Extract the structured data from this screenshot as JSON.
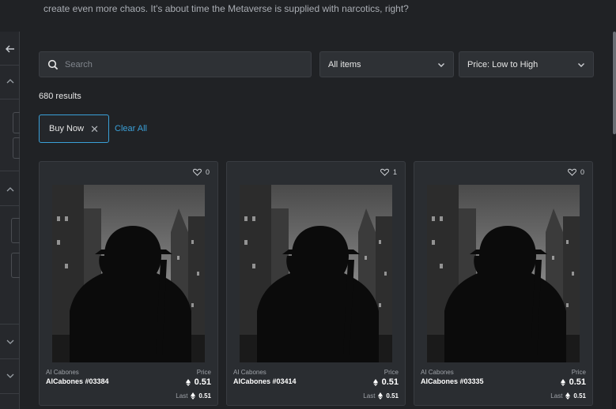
{
  "banner": {
    "description": "create even more chaos. It's about time the Metaverse is supplied with narcotics, right?"
  },
  "search": {
    "placeholder": "Search"
  },
  "filters": {
    "items_selected": "All items",
    "sort_selected": "Price: Low to High"
  },
  "results": {
    "count_text": "680 results"
  },
  "active_filters": {
    "chip_label": "Buy Now",
    "clear_label": "Clear All"
  },
  "cards": [
    {
      "collection": "AI Cabones",
      "token": "AICabones #03384",
      "likes": "0",
      "price_label": "Price",
      "price": "0.51",
      "last_label": "Last",
      "last": "0.51"
    },
    {
      "collection": "AI Cabones",
      "token": "AICabones #03414",
      "likes": "1",
      "price_label": "Price",
      "price": "0.51",
      "last_label": "Last",
      "last": "0.51"
    },
    {
      "collection": "AI Cabones",
      "token": "AICabones #03335",
      "likes": "0",
      "price_label": "Price",
      "price": "0.51",
      "last_label": "Last",
      "last": "0.51"
    }
  ],
  "colors": {
    "accent": "#3aa0d8",
    "background": "#202225",
    "card": "#2a2d31"
  },
  "icons": {
    "sidebar": [
      "collapse-arrow-icon",
      "chevron-up-icon",
      "chevron-up-icon",
      "chevron-down-icon",
      "chevron-down-icon"
    ],
    "search": "search-icon",
    "dropdown": "chevron-down-icon",
    "like": "heart-icon",
    "currency": "eth-icon",
    "remove": "close-icon"
  }
}
